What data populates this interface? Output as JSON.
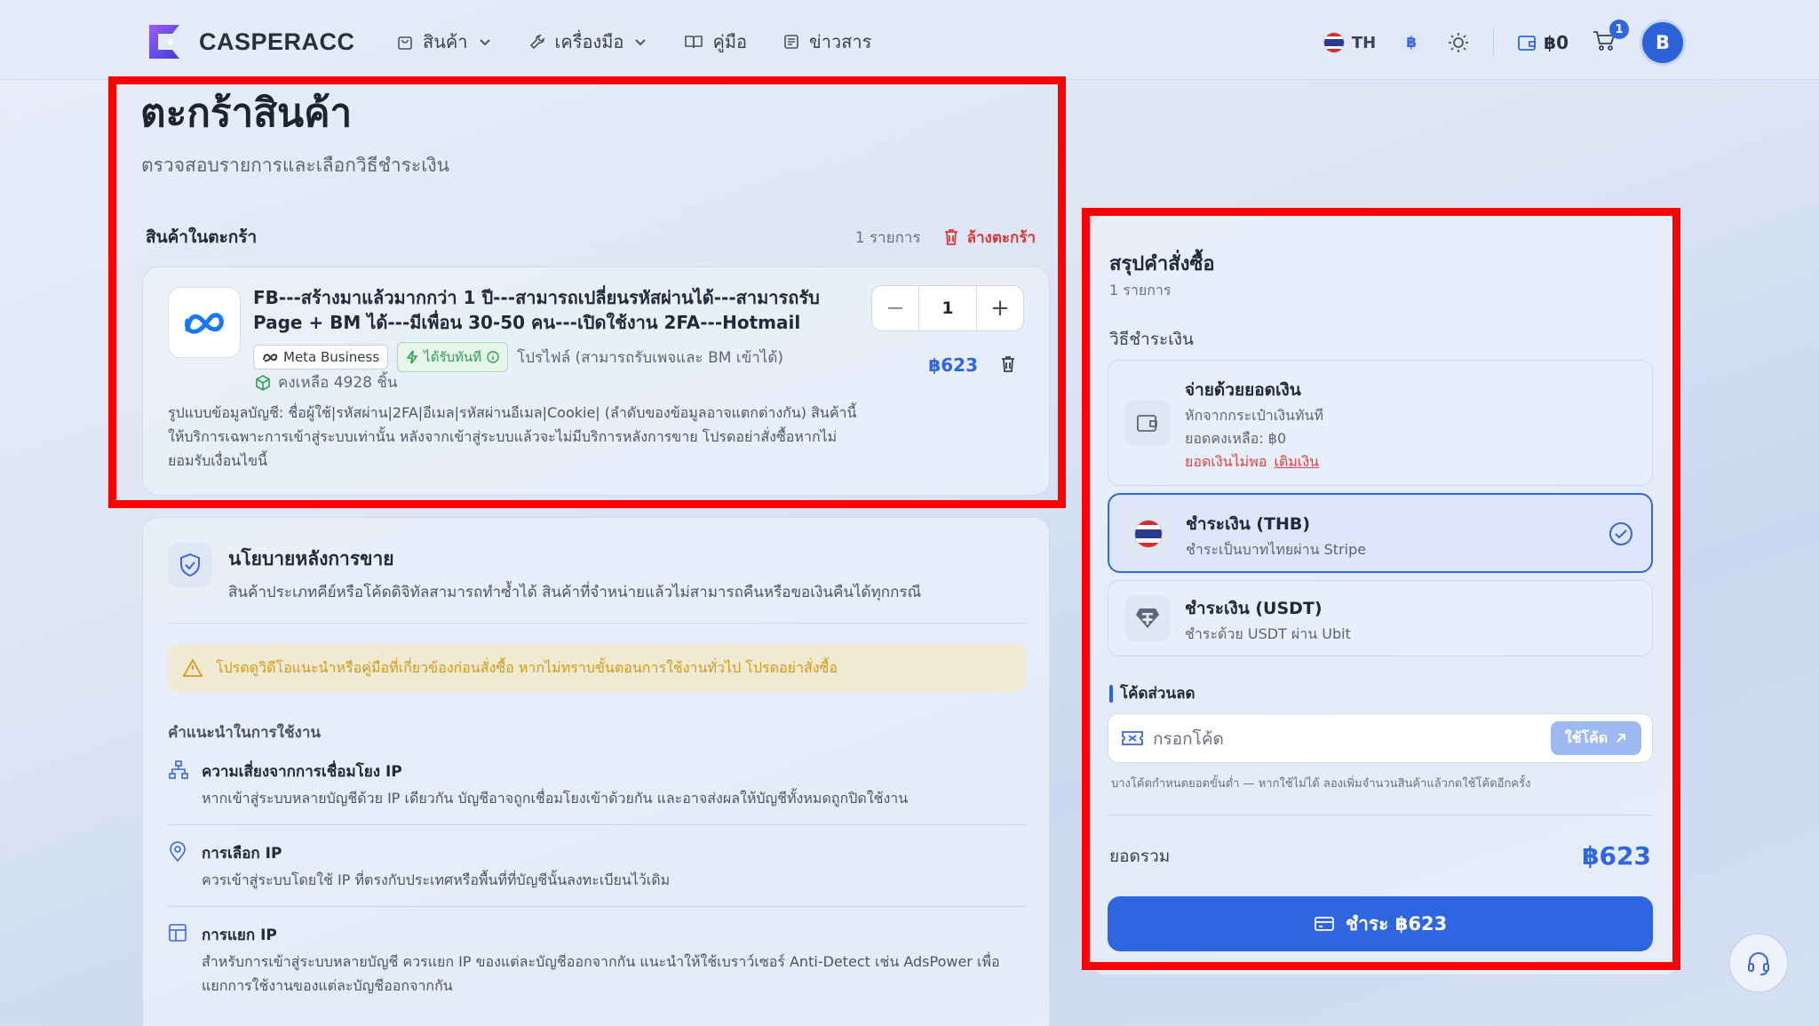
{
  "header": {
    "brand": "CASPERACC",
    "nav": [
      {
        "label": "สินค้า",
        "icon": "bag-icon",
        "dropdown": true
      },
      {
        "label": "เครื่องมือ",
        "icon": "wrench-icon",
        "dropdown": true
      },
      {
        "label": "คู่มือ",
        "icon": "book-icon",
        "dropdown": false
      },
      {
        "label": "ข่าวสาร",
        "icon": "news-icon",
        "dropdown": false
      }
    ],
    "language": "TH",
    "currency_symbol": "฿",
    "wallet_balance": "฿0",
    "cart_count": "1",
    "avatar_initial": "B"
  },
  "page": {
    "title": "ตะกร้าสินค้า",
    "subtitle": "ตรวจสอบรายการและเลือกวิธีชำระเงิน"
  },
  "cart": {
    "section_label": "สินค้าในตะกร้า",
    "item_count": "1 รายการ",
    "clear_label": "ล้างตะกร้า",
    "item": {
      "title": "FB---สร้างมาแล้วมากกว่า 1 ปี---สามารถเปลี่ยนรหัสผ่านได้---สามารถรับ Page + BM ได้---มีเพื่อน 30-50 คน---เปิดใช้งาน 2FA---Hotmail",
      "tag_brand": "Meta Business",
      "tag_instant": "ได้รับทันที",
      "tag_note": "โปรไฟล์ (สามารถรับเพจและ BM เข้าได้)",
      "stock": "คงเหลือ 4928 ชิ้น",
      "quantity": "1",
      "price": "฿623",
      "description": "รูปแบบข้อมูลบัญชี: ชื่อผู้ใช้|รหัสผ่าน|2FA|อีเมล|รหัสผ่านอีเมล|Cookie| (ลำดับของข้อมูลอาจแตกต่างกัน) สินค้านี้ให้บริการเฉพาะการเข้าสู่ระบบเท่านั้น หลังจากเข้าสู่ระบบแล้วจะไม่มีบริการหลังการขาย โปรดอย่าสั่งซื้อหากไม่ยอมรับเงื่อนไขนี้"
    }
  },
  "policy": {
    "title": "นโยบายหลังการขาย",
    "subtitle": "สินค้าประเภทคีย์หรือโค้ดดิจิทัลสามารถทำซ้ำได้ สินค้าที่จำหน่ายแล้วไม่สามารถคืนหรือขอเงินคืนได้ทุกกรณี",
    "warning": "โปรดดูวิดีโอแนะนำหรือคู่มือที่เกี่ยวข้องก่อนสั่งซื้อ หากไม่ทราบขั้นตอนการใช้งานทั่วไป โปรดอย่าสั่งซื้อ",
    "tips_heading": "คำแนะนำในการใช้งาน",
    "tips": [
      {
        "title": "ความเสี่ยงจากการเชื่อมโยง IP",
        "desc": "หากเข้าสู่ระบบหลายบัญชีด้วย IP เดียวกัน บัญชีอาจถูกเชื่อมโยงเข้าด้วยกัน และอาจส่งผลให้บัญชีทั้งหมดถูกปิดใช้งาน",
        "icon": "network-icon"
      },
      {
        "title": "การเลือก IP",
        "desc": "ควรเข้าสู่ระบบโดยใช้ IP ที่ตรงกับประเทศหรือพื้นที่ที่บัญชีนั้นลงทะเบียนไว้เดิม",
        "icon": "location-pin-icon"
      },
      {
        "title": "การแยก IP",
        "desc": "สำหรับการเข้าสู่ระบบหลายบัญชี ควรแยก IP ของแต่ละบัญชีออกจากกัน แนะนำให้ใช้เบราว์เซอร์ Anti-Detect เช่น AdsPower เพื่อแยกการใช้งานของแต่ละบัญชีออกจากกัน",
        "icon": "layout-icon"
      }
    ]
  },
  "summary": {
    "title": "สรุปคำสั่งซื้อ",
    "count": "1 รายการ",
    "payment_label": "วิธีชำระเงิน",
    "options": [
      {
        "name": "จ่ายด้วยยอดเงิน",
        "desc": "หักจากกระเป๋าเงินทันที",
        "balance": "ยอดคงเหลือ: ฿0",
        "warn": "ยอดเงินไม่พอ",
        "topup": "เติมเงิน",
        "icon": "wallet-icon"
      },
      {
        "name": "ชำระเงิน (THB)",
        "desc": "ชำระเป็นบาทไทยผ่าน Stripe",
        "icon": "thai-flag-icon",
        "selected": true
      },
      {
        "name": "ชำระเงิน (USDT)",
        "desc": "ชำระด้วย USDT ผ่าน Ubit",
        "icon": "tether-icon"
      }
    ],
    "coupon_label": "โค้ดส่วนลด",
    "coupon_placeholder": "กรอกโค้ด",
    "coupon_button": "ใช้โค้ด",
    "coupon_note": "บางโค้ดกำหนดยอดขั้นต่ำ — หากใช้ไม่ได้ ลองเพิ่มจำนวนสินค้าแล้วกดใช้โค้ดอีกครั้ง",
    "total_label": "ยอดรวม",
    "total_value": "฿623",
    "pay_button": "ชำระ ฿623"
  },
  "colors": {
    "accent": "#2f66e0",
    "danger": "#d83a3a",
    "highlight": "#ff0000"
  }
}
